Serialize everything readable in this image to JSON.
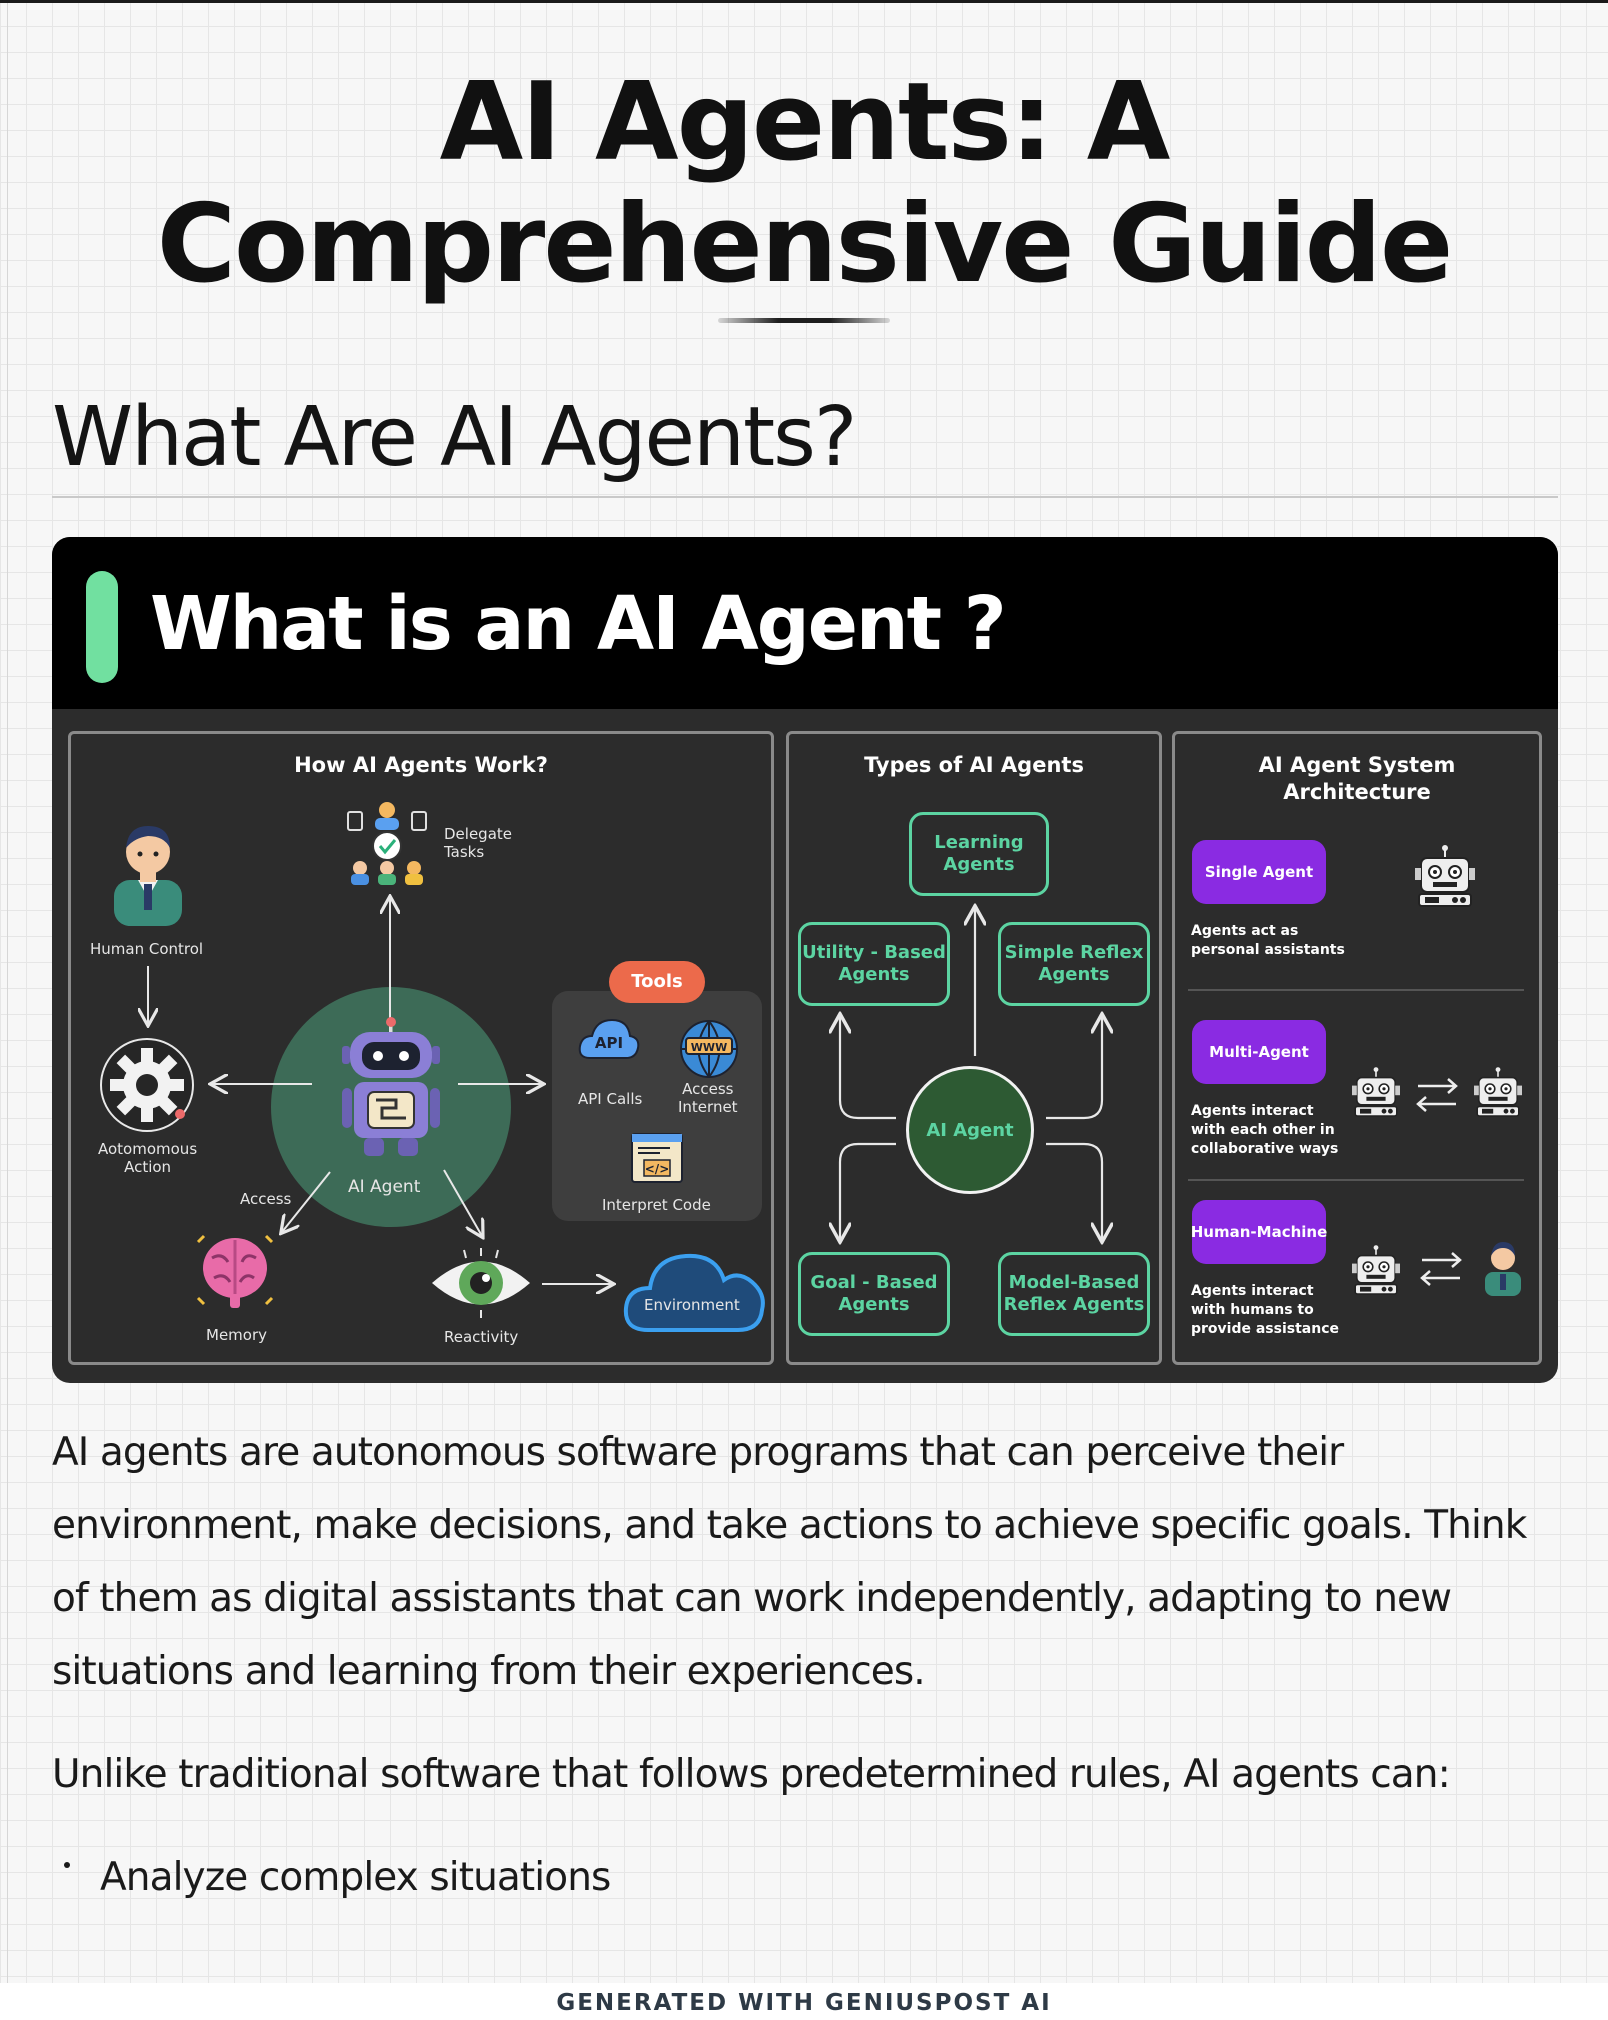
{
  "article": {
    "title": "AI Agents: A Comprehensive Guide",
    "section_heading": "What Are AI Agents?",
    "paragraphs": [
      "AI agents are autonomous software programs that can perceive their environment, make decisions, and take actions to achieve specific goals. Think of them as digital assistants that can work independently, adapting to new situations and learning from their experiences.",
      "Unlike traditional software that follows predetermined rules, AI agents can:"
    ],
    "bullets": [
      "Analyze complex situations"
    ]
  },
  "infographic": {
    "title": "What is an AI Agent ?",
    "accent_color": "#71e0a0",
    "how_it_works": {
      "title": "How AI Agents Work?",
      "human_control": "Human Control",
      "delegate": "Delegate\nTasks",
      "autonomous": "Aotomomous\nAction",
      "agent": "AI Agent",
      "access": "Access",
      "memory": "Memory",
      "reactivity": "Reactivity",
      "environment": "Environment",
      "tools": {
        "label": "Tools",
        "api": "API Calls",
        "api_icon_text": "API",
        "internet": "Access\nInternet",
        "www_text": "WWW",
        "code": "Interpret Code",
        "code_icon_text": "</>"
      },
      "icons": [
        "person-icon",
        "delegate-team-icon",
        "gear-icon",
        "robot-icon",
        "brain-icon",
        "eye-icon",
        "cloud-icon",
        "api-icon",
        "globe-icon",
        "code-window-icon"
      ]
    },
    "types": {
      "title": "Types of AI Agents",
      "learning": "Learning\nAgents",
      "utility": "Utility - Based\nAgents",
      "simple_reflex": "Simple Reflex\nAgents",
      "core": "AI Agent",
      "goal": "Goal - Based\nAgents",
      "model_reflex": "Model-Based\nReflex Agents",
      "accent_color": "#5cd4a2"
    },
    "architecture": {
      "title": "AI Agent System\nArchitecture",
      "pill_color": "#8a2be2",
      "items": [
        {
          "label": "Single Agent",
          "desc": "Agents act as\npersonal assistants"
        },
        {
          "label": "Multi-Agent",
          "desc": "Agents interact\nwith each other in\ncollaborative ways"
        },
        {
          "label": "Human-Machine",
          "desc": "Agents interact\nwith humans to\nprovide assistance"
        }
      ]
    }
  },
  "footer": "GENERATED WITH GENIUSPOST AI"
}
